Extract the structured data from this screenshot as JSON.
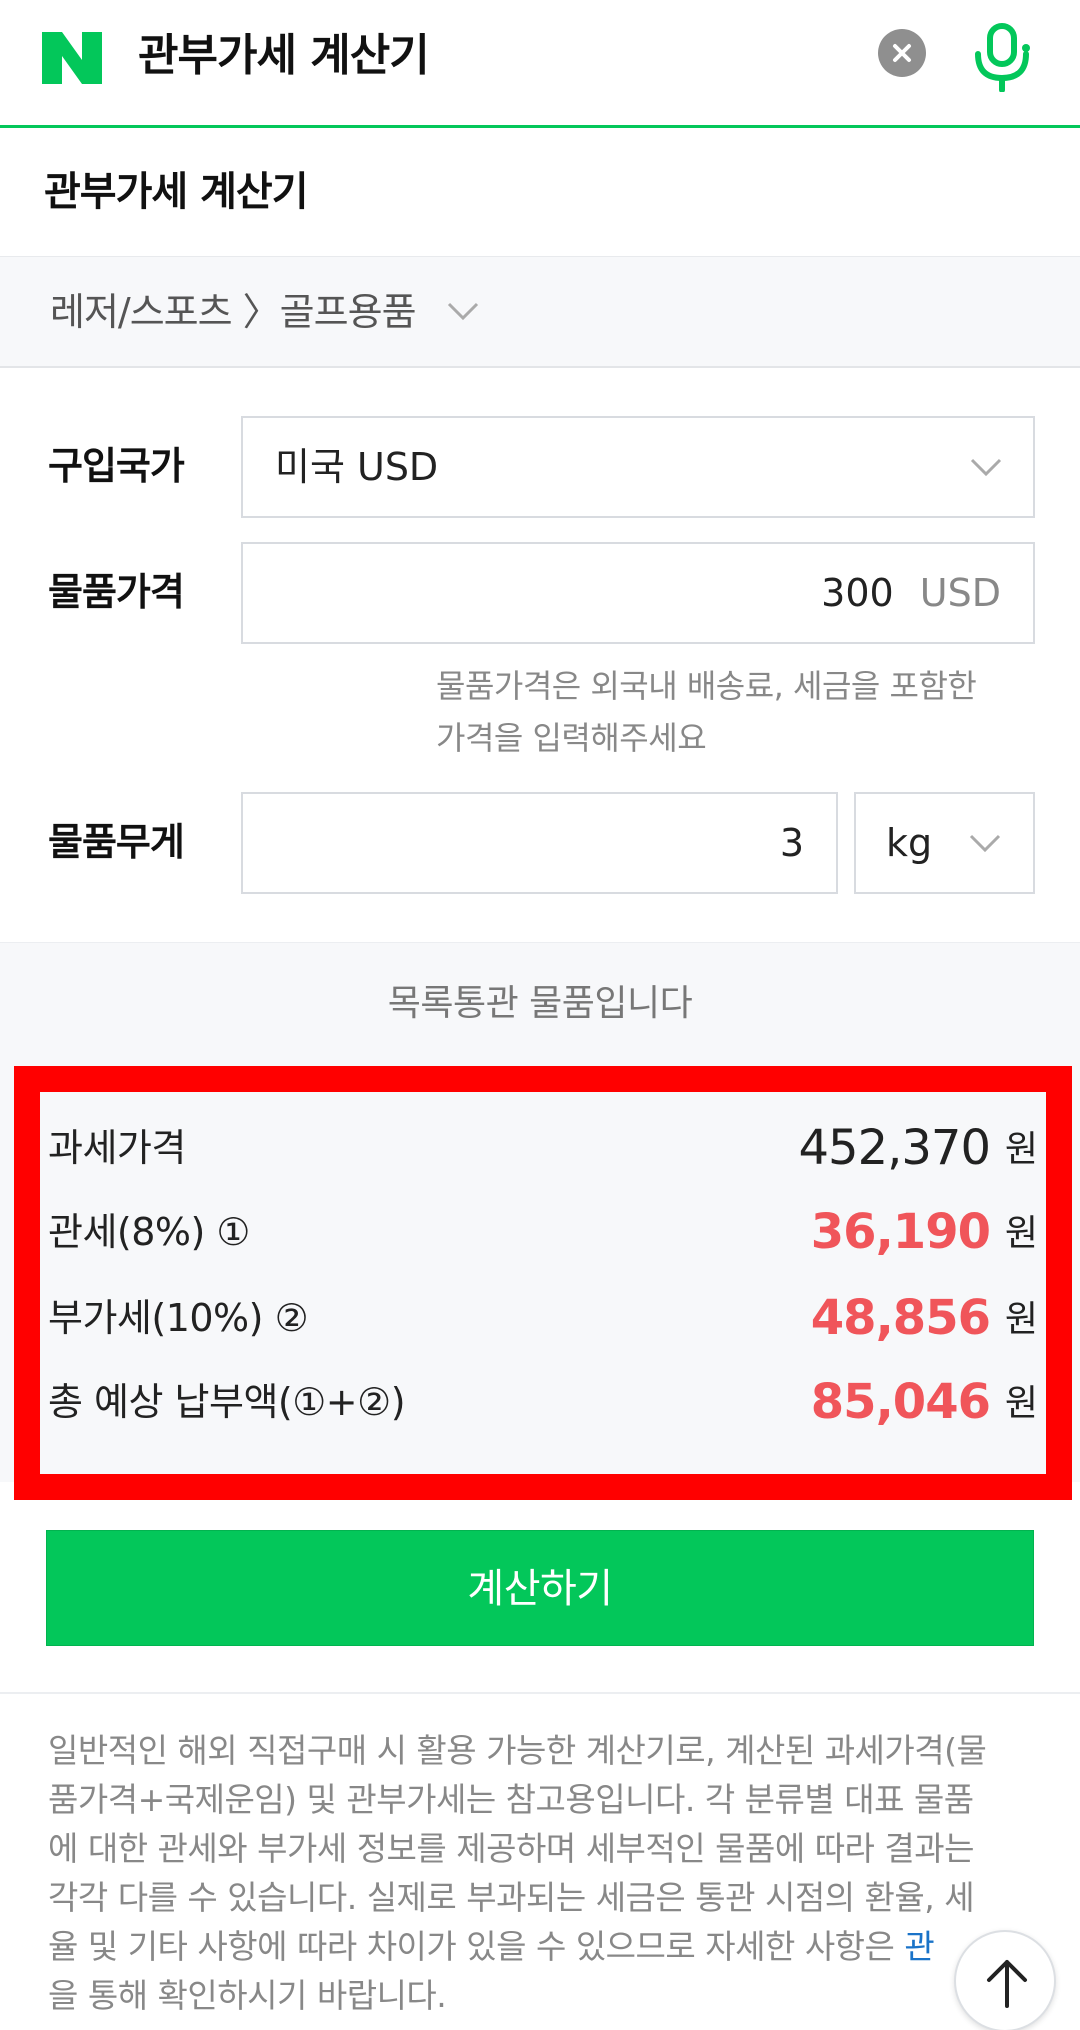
{
  "search": {
    "query": "관부가세 계산기",
    "logo_letter": "N",
    "clear_icon": "close-icon",
    "mic_icon": "microphone-icon"
  },
  "card": {
    "title": "관부가세 계산기"
  },
  "category": {
    "path": "레저/스포츠 〉골프용품",
    "icon": "chevron-down-icon"
  },
  "form": {
    "country_label": "구입국가",
    "country_value": "미국 USD",
    "price_label": "물품가격",
    "price_value": "300",
    "price_unit": "USD",
    "price_hint_line1": "물품가격은 외국내 배송료, 세금을 포함한",
    "price_hint_line2": "가격을 입력해주세요",
    "weight_label": "물품무게",
    "weight_value": "3",
    "weight_unit": "kg"
  },
  "result": {
    "notice": "목록통관 물품입니다",
    "rows": [
      {
        "label": "과세가격",
        "value": "452,370",
        "unit": "원"
      },
      {
        "label": "관세(8%) ①",
        "value": "36,190",
        "unit": "원"
      },
      {
        "label": "부가세(10%) ②",
        "value": "48,856",
        "unit": "원"
      },
      {
        "label": "총 예상 납부액(①+②)",
        "value": "85,046",
        "unit": "원"
      }
    ]
  },
  "actions": {
    "calculate_label": "계산하기"
  },
  "disclaimer": {
    "line1": "일반적인 해외 직접구매 시 활용 가능한 계산기로, 계산된 과세가격(물",
    "line2": "품가격+국제운임) 및 관부가세는 참고용입니다. 각 분류별 대표 물품",
    "line3": "에 대한 관세와 부가세 정보를 제공하며 세부적인 물품에 따라 결과는",
    "line4": "각각 다를 수 있습니다. 실제로 부과되는 세금은 통관 시점의 환율, 세",
    "line5_text": "율 및 기타 사항에 따라 차이가 있을 수 있으므로 자세한 사항은 ",
    "line5_link": "관",
    "line6": "을 통해 확인하시기 바랍니다."
  },
  "scroll_top_icon": "arrow-up-icon",
  "colors": {
    "naver_green": "#03c75a",
    "highlight_red": "#ff0000",
    "value_red": "#f0555a"
  }
}
